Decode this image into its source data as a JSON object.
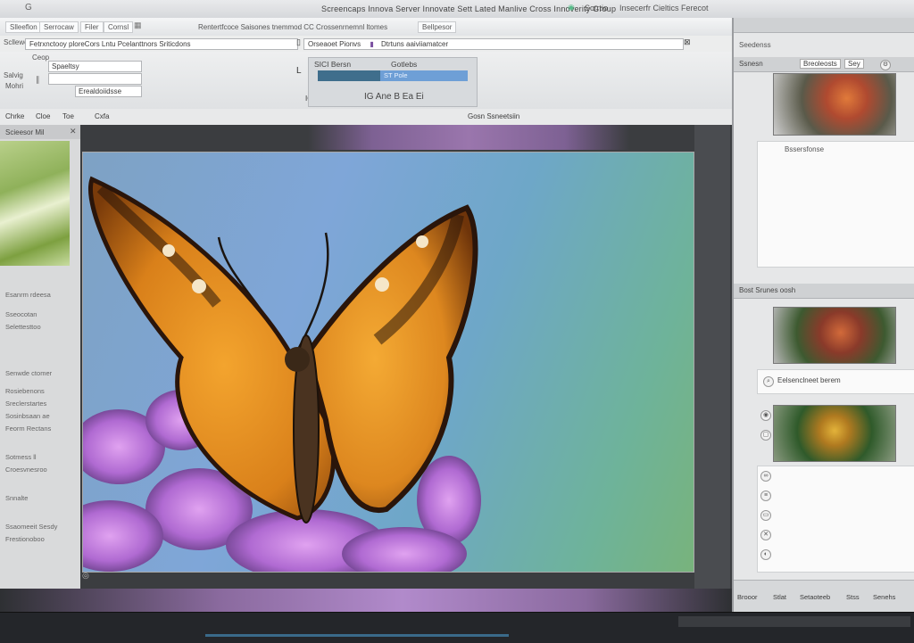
{
  "titlebar": {
    "app_icon": "G",
    "title": "Screencaps Innova Server Innovate Sett Lated Manlive Cross Innoverity Group",
    "controls": [
      "Scrrtio",
      "Insecerfr Cieltics Ferecot"
    ]
  },
  "menubar": {
    "items": [
      "Slleeflon",
      "Serrocaw",
      "Filer",
      "Cornsl"
    ],
    "toolbar_strip": "Rentertfcoce Saisones tnemmod CC Crossenrnemnl ltomes",
    "right_label": "Bellpesor"
  },
  "pathbar": {
    "path_label": "Scllewcr",
    "path_value": "Fetrxnctooy ploreCors Lntu Pcelanttnors Sriticdons",
    "path_value2": "Orseaoet Pionvs",
    "path_value3": "Dtrtuns aaiviiamatcer"
  },
  "optionsbar": {
    "left_labels": [
      "Ceop",
      "Salvig",
      "Mohri"
    ],
    "input_value": "Spaeltsy",
    "input_value2": "Erealdoiidsse",
    "layer_label": "SICI Bersn",
    "layer_label2": "Gotlebs",
    "layer_value": "ST Pole",
    "layer_buttons": "IG Ane B Ea Ei",
    "side_mark": "L",
    "side_mark2": "IG"
  },
  "subbar": {
    "items": [
      "Chrke",
      "Cloe",
      "Toe",
      "Cxfa"
    ],
    "right_item": "Gosn Ssneetsiin"
  },
  "leftpanel": {
    "header": "Scieesor Mil",
    "lines": [
      "Esanrm rdeesa",
      "Sseocotan",
      "Selettesttoo",
      "Senwde ctomer",
      "Rosiebenons",
      "Sreclerstartes",
      "Sosinbsaan ae",
      "Feorm Rectans",
      "Sotmess ll",
      "Croesvnesroo",
      "Snnalte",
      "Ssaomeeit Sesdy",
      "Frestionoboo"
    ]
  },
  "rightpanel": {
    "top_header": "Seedenss",
    "panel1_label": "Ssnesn",
    "panel1_tabs": [
      "Breoleosts",
      "Sey"
    ],
    "panel2_label": "Bssersfonse",
    "panel3_label": "Bost Srunes oosh",
    "panel4_label": "Eelsenclneet berem",
    "bottom_tabs": [
      "Brooor",
      "Stlat",
      "Setaoteeb",
      "Stss",
      "Senehs"
    ]
  },
  "colors": {
    "canvas_sky": "#7fa6d8",
    "butterfly_orange": "#e08a1e",
    "flower_purple": "#a86ad0",
    "chrome_bg": "#e6e7e8"
  }
}
